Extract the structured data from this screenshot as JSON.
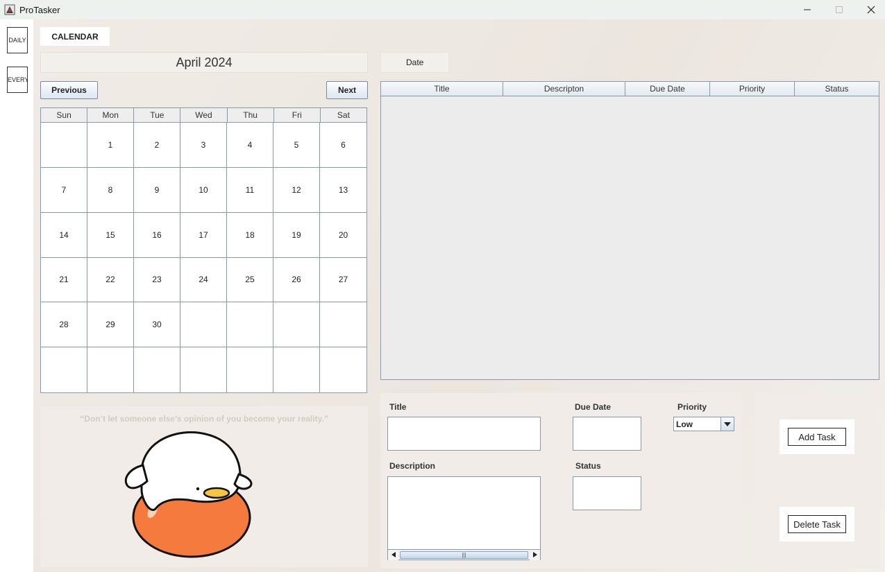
{
  "window": {
    "title": "ProTasker",
    "controls": {
      "minimize": "minimize-icon",
      "maximize": "maximize-icon",
      "close": "close-icon"
    }
  },
  "sidebar": {
    "tabs": [
      {
        "label": "DAILY"
      },
      {
        "label": "EVERYDAY"
      }
    ]
  },
  "main_tabs": {
    "calendar": "CALENDAR"
  },
  "calendar": {
    "month_label": "April 2024",
    "previous_label": "Previous",
    "next_label": "Next",
    "weekdays": [
      "Sun",
      "Mon",
      "Tue",
      "Wed",
      "Thu",
      "Fri",
      "Sat"
    ],
    "days": [
      "",
      "1",
      "2",
      "3",
      "4",
      "5",
      "6",
      "7",
      "8",
      "9",
      "10",
      "11",
      "12",
      "13",
      "14",
      "15",
      "16",
      "17",
      "18",
      "19",
      "20",
      "21",
      "22",
      "23",
      "24",
      "25",
      "26",
      "27",
      "28",
      "29",
      "30",
      "",
      "",
      "",
      "",
      "",
      "",
      "",
      "",
      "",
      "",
      ""
    ]
  },
  "quote": {
    "text": "“Don’t let someone else’s opinion of you become your reality.”"
  },
  "date_field": {
    "label": "Date"
  },
  "task_table": {
    "columns": [
      "Title",
      "Descripton",
      "Due Date",
      "Priority",
      "Status"
    ],
    "rows": []
  },
  "form": {
    "title_label": "Title",
    "title_value": "",
    "due_date_label": "Due Date",
    "due_date_value": "",
    "priority_label": "Priority",
    "priority_value": "Low",
    "description_label": "Description",
    "description_value": "",
    "status_label": "Status",
    "status_value": ""
  },
  "actions": {
    "add_label": "Add Task",
    "delete_label": "Delete Task"
  },
  "colors": {
    "mascot_body": "#f47a3e",
    "mascot_head": "#ffffff",
    "mascot_beak": "#f5c542"
  }
}
